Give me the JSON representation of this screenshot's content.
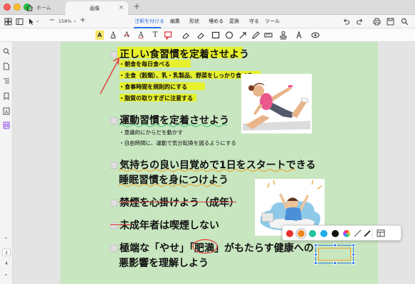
{
  "tabs": {
    "home_label": "ホーム",
    "doc_label": "画像"
  },
  "toolbar": {
    "zoom": "158%",
    "menu": [
      "注釈を付ける",
      "編集",
      "形状",
      "埋める",
      "変換",
      "守る",
      "ツール"
    ],
    "active_menu": "注釈を付ける"
  },
  "annotation_tools": [
    "highlight-icon",
    "text-color-icon",
    "strikethrough-icon",
    "underline-icon",
    "text-icon",
    "comment-icon",
    "rectangle-icon",
    "circle-icon",
    "arrow-icon",
    "pencil-icon",
    "ruler-icon",
    "stamp-icon",
    "pen-icon",
    "eye-icon"
  ],
  "sidebar": {
    "current_page": "2",
    "next_page": "4"
  },
  "document": {
    "section1_title": "正しい食習慣を定着させよう",
    "section1_items": [
      "・朝食を毎日食べる",
      "・主食（穀類）、乳・乳製品、野菜をしっかり食べる",
      "・食事時間を規則的にする",
      "・脂質の取りすぎに注意する"
    ],
    "section2_title": "運動習慣を定着させよう",
    "section2_items": [
      "・意識的にからだを動かす",
      "・自由時間に、運動で気分転換を図るようにする"
    ],
    "section3_line1": "気持ちの良い目覚めで1日をスタートできる",
    "section3_line2": "睡眠習慣を身につけよう",
    "section4_title": "禁煙を心掛けよう（成年）",
    "section5_title": "未成年者は喫煙しない",
    "section6_pre": "極端な「やせ」「",
    "section6_circled": "肥満",
    "section6_post": "」がもたらす健康への",
    "section6_line2": "悪影響を理解しよう"
  },
  "colors": {
    "page_bg": "#c8e6c0",
    "highlight": "#e6f02c",
    "accent": "#2a6de0",
    "palette": [
      "#e8302e",
      "#f0881e",
      "#22c39a",
      "#1eaee8",
      "#111111",
      "rainbow"
    ]
  }
}
